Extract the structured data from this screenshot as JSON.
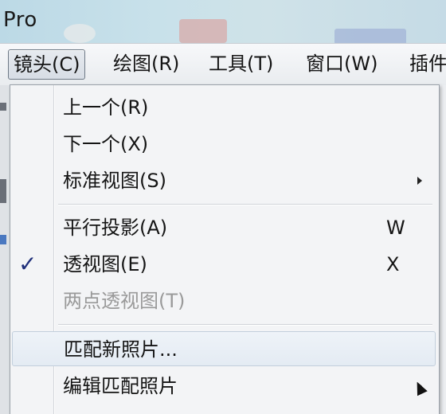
{
  "titlebar": {
    "title": "Pro"
  },
  "menubar": {
    "items": [
      {
        "label": "镜头(C)",
        "active": true
      },
      {
        "label": "绘图(R)"
      },
      {
        "label": "工具(T)"
      },
      {
        "label": "窗口(W)"
      },
      {
        "label": "插件"
      }
    ]
  },
  "dropdown": {
    "items": [
      {
        "label": "上一个(R)",
        "shortcut": ""
      },
      {
        "label": "下一个(X)",
        "shortcut": ""
      },
      {
        "label": "标准视图(S)",
        "submenu": true
      },
      {
        "label": "平行投影(A)",
        "shortcut": "W"
      },
      {
        "label": "透视图(E)",
        "shortcut": "X",
        "checked": true
      },
      {
        "label": "两点透视图(T)",
        "disabled": true
      },
      {
        "label": "匹配新照片...",
        "highlighted": true
      },
      {
        "label": "编辑匹配照片",
        "submenu": true
      }
    ],
    "check_glyph": "✓"
  },
  "colors": {
    "check": "#1f2f7a",
    "disabled_text": "#9a9a9a",
    "menu_bg": "#f3f4f6"
  }
}
